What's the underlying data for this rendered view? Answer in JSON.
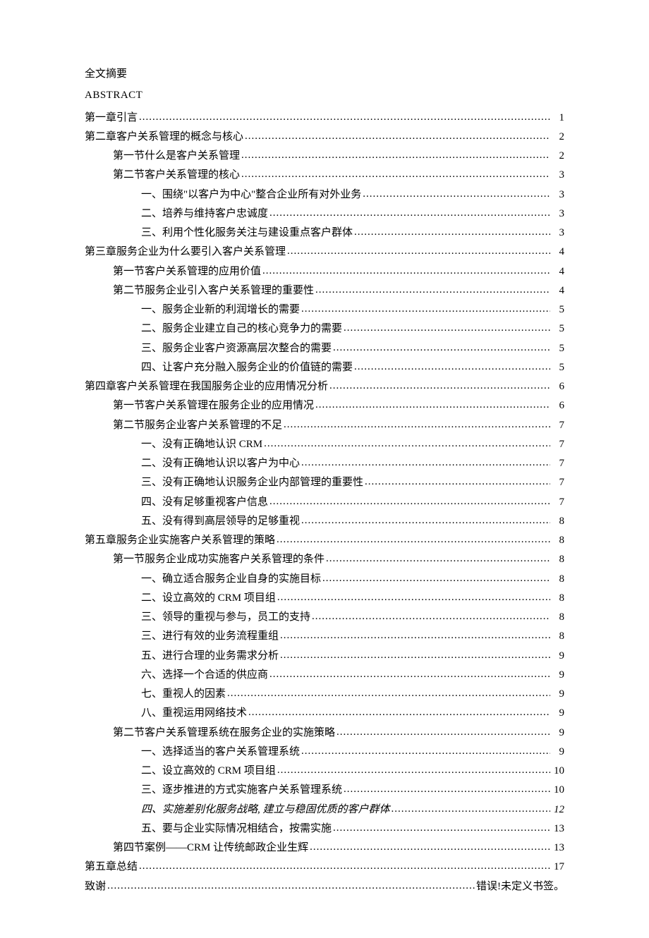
{
  "summary_label": "全文摘要",
  "abstract_label": "ABSTRACT",
  "error_bookmark": "错误!未定义书签。",
  "toc": [
    {
      "level": 1,
      "title": "第一章引言",
      "page": "1"
    },
    {
      "level": 1,
      "title": "第二章客户关系管理的概念与核心",
      "page": "2"
    },
    {
      "level": 2,
      "title": "第一节什么是客户关系管理",
      "page": "2"
    },
    {
      "level": 2,
      "title": "第二节客户关系管理的核心",
      "page": "3"
    },
    {
      "level": 3,
      "title": "一、围绕\"以客户为中心\"整合企业所有对外业务",
      "page": "3"
    },
    {
      "level": 3,
      "title": "二、培养与维持客户忠诚度",
      "page": "3"
    },
    {
      "level": 3,
      "title": "三、利用个性化服务关注与建设重点客户群体",
      "page": "3"
    },
    {
      "level": 1,
      "title": "第三章服务企业为什么要引入客户关系管理",
      "page": "4"
    },
    {
      "level": 2,
      "title": "第一节客户关系管理的应用价值",
      "page": "4"
    },
    {
      "level": 2,
      "title": "第二节服务企业引入客户关系管理的重要性",
      "page": "4"
    },
    {
      "level": 3,
      "title": "一、服务企业新的利润增长的需要",
      "page": "5"
    },
    {
      "level": 3,
      "title": "二、服务企业建立自己的核心竞争力的需要",
      "page": "5"
    },
    {
      "level": 3,
      "title": "三、服务企业客户资源高层次整合的需要",
      "page": "5"
    },
    {
      "level": 3,
      "title": "四、让客户充分融入服务企业的价值链的需要",
      "page": "5"
    },
    {
      "level": 1,
      "title": "第四章客户关系管理在我国服务企业的应用情况分析",
      "page": "6"
    },
    {
      "level": 2,
      "title": "第一节客户关系管理在服务企业的应用情况",
      "page": "6"
    },
    {
      "level": 2,
      "title": "第二节服务企业客户关系管理的不足",
      "page": "7"
    },
    {
      "level": 3,
      "title": "一、没有正确地认识 CRM",
      "page": "7"
    },
    {
      "level": 3,
      "title": "二、没有正确地认识以客户为中心",
      "page": "7"
    },
    {
      "level": 3,
      "title": "三、没有正确地认识服务企业内部管理的重要性",
      "page": "7"
    },
    {
      "level": 3,
      "title": "四、没有足够重视客户信息",
      "page": "7"
    },
    {
      "level": 3,
      "title": "五、没有得到高层领导的足够重视",
      "page": "8"
    },
    {
      "level": 1,
      "title": "第五章服务企业实施客户关系管理的策略",
      "page": "8"
    },
    {
      "level": 2,
      "title": "第一节服务企业成功实施客户关系管理的条件",
      "page": "8"
    },
    {
      "level": 3,
      "title": "一、确立适合服务企业自身的实施目标",
      "page": "8"
    },
    {
      "level": 3,
      "title": "二、设立高效的 CRM 项目组",
      "page": "8"
    },
    {
      "level": 3,
      "title": "三、领导的重视与参与，员工的支持",
      "page": "8"
    },
    {
      "level": 3,
      "title": "三、进行有效的业务流程重组",
      "page": "8"
    },
    {
      "level": 3,
      "title": "五、进行合理的业务需求分析",
      "page": "9"
    },
    {
      "level": 3,
      "title": "六、选择一个合适的供应商",
      "page": "9"
    },
    {
      "level": 3,
      "title": "七、重视人的因素",
      "page": "9"
    },
    {
      "level": 3,
      "title": "八、重视运用网络技术",
      "page": "9"
    },
    {
      "level": 2,
      "title": "第二节客户关系管理系统在服务企业的实施策略",
      "page": "9"
    },
    {
      "level": 3,
      "title": "一、选择适当的客户关系管理系统",
      "page": "9"
    },
    {
      "level": 3,
      "title": "二、设立高效的 CRM 项目组",
      "page": "10"
    },
    {
      "level": 3,
      "title": "三、逐步推进的方式实施客户关系管理系统",
      "page": "10"
    },
    {
      "level": 3,
      "title": "四、实施差别化服务战略, 建立与稳固优质的客户群体",
      "page": "12",
      "italic": true
    },
    {
      "level": 3,
      "title": "五、要与企业实际情况相结合，按需实施",
      "page": "13"
    },
    {
      "level": 2,
      "title": "第四节案例——CRM 让传统邮政企业生辉",
      "page": "13"
    },
    {
      "level": 1,
      "title": "第五章总结",
      "page": "17"
    },
    {
      "level": 1,
      "title": "致谢",
      "page_text": "error_bookmark"
    }
  ]
}
